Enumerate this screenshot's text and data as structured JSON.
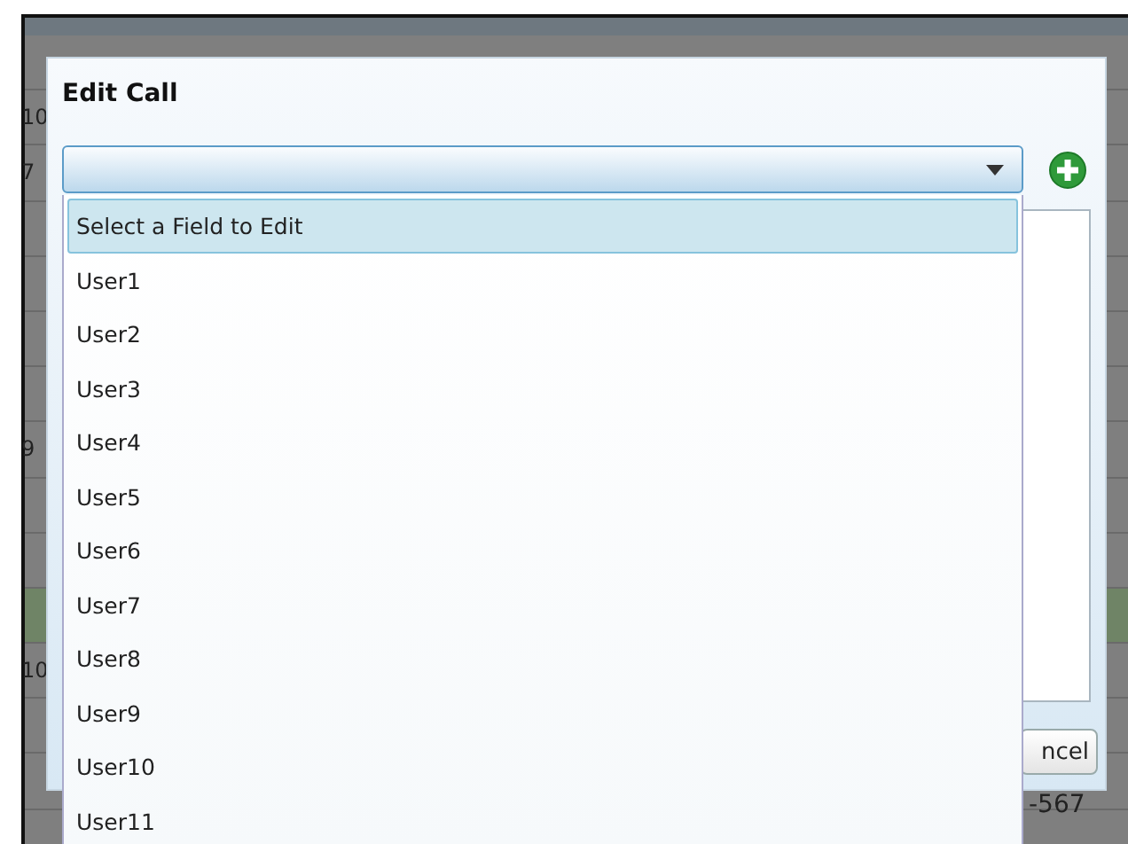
{
  "background_table": {
    "rows": [
      {
        "column_1": "",
        "highlighted": false
      },
      {
        "column_1": "10",
        "highlighted": false
      },
      {
        "column_1": "7",
        "highlighted": false
      },
      {
        "column_1": "",
        "highlighted": false
      },
      {
        "column_1": "",
        "highlighted": false
      },
      {
        "column_1": "",
        "highlighted": false
      },
      {
        "column_1": "",
        "highlighted": false
      },
      {
        "column_1": "9",
        "highlighted": false
      },
      {
        "column_1": "",
        "highlighted": false
      },
      {
        "column_1": "",
        "highlighted": false
      },
      {
        "column_1": "",
        "highlighted": true
      },
      {
        "column_1": "10",
        "highlighted": false
      },
      {
        "column_1": "",
        "highlighted": false
      },
      {
        "column_1": "",
        "highlighted": false
      },
      {
        "column_1": "",
        "highlighted": false
      }
    ],
    "footer_text": "-567"
  },
  "dialog": {
    "title": "Edit Call",
    "field_select": {
      "expanded": true,
      "options": [
        {
          "label": "Select a Field to Edit",
          "selected": true
        },
        {
          "label": "User1",
          "selected": false
        },
        {
          "label": "User2",
          "selected": false
        },
        {
          "label": "User3",
          "selected": false
        },
        {
          "label": "User4",
          "selected": false
        },
        {
          "label": "User5",
          "selected": false
        },
        {
          "label": "User6",
          "selected": false
        },
        {
          "label": "User7",
          "selected": false
        },
        {
          "label": "User8",
          "selected": false
        },
        {
          "label": "User9",
          "selected": false
        },
        {
          "label": "User10",
          "selected": false
        },
        {
          "label": "User11",
          "selected": false
        }
      ]
    },
    "cancel_button": "ncel"
  }
}
